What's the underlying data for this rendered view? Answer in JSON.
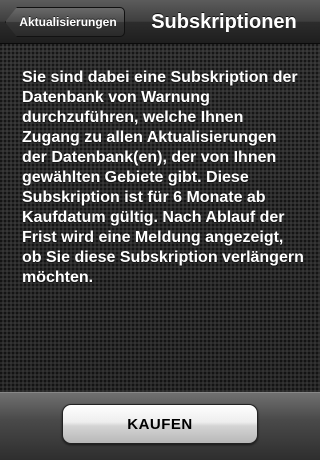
{
  "navbar": {
    "back_label": "Aktualisierungen",
    "title": "Subskriptionen"
  },
  "main": {
    "message": "Sie sind dabei eine Subskription der Datenbank von Warnung durchzuführen, welche Ihnen Zugang zu allen Aktualisierungen der Datenbank(en), der von Ihnen gewählten Gebiete gibt. Diese Subskription ist für 6 Monate ab Kaufdatum gültig. Nach Ablauf der Frist wird eine Meldung angezeigt, ob Sie diese Subskription verlängern möchten."
  },
  "footer": {
    "buy_label": "KAUFEN"
  }
}
